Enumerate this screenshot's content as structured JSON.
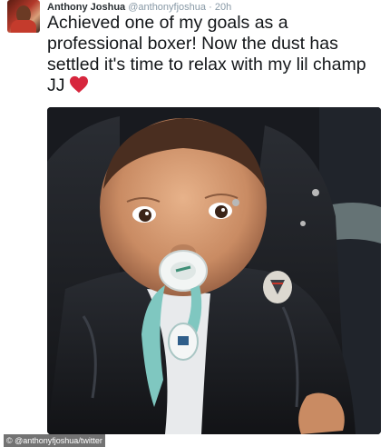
{
  "tweet": {
    "display_name": "Anthony Joshua",
    "handle": "@anthonyfjoshua",
    "separator": "·",
    "timestamp": "20h",
    "text": "Achieved one of my goals as a professional boxer! Now the dust has settled it's time to relax with my lil champ JJ",
    "emoji": "heart-emoji",
    "heart_color": "#d7263d"
  },
  "media": {
    "credit": "© @anthonyfjoshua/twitter"
  }
}
